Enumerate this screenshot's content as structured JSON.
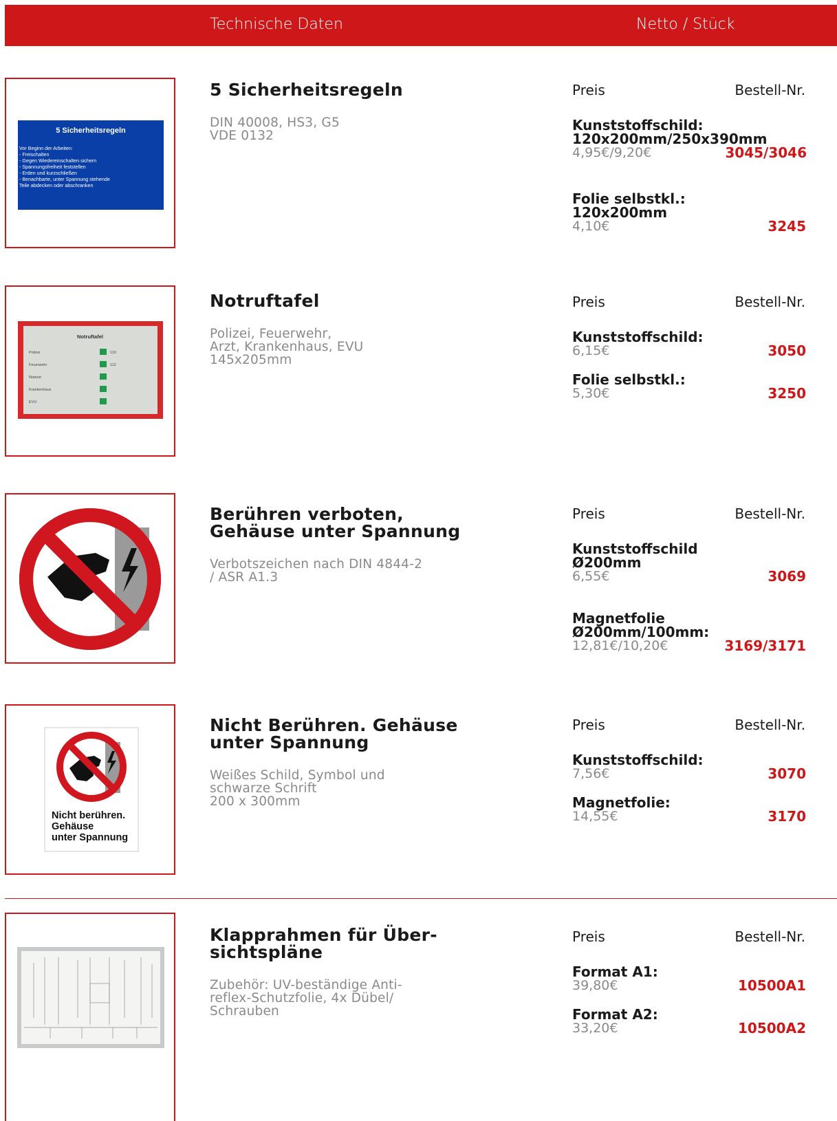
{
  "header": {
    "left": "Technische Daten",
    "right": "Netto / Stück"
  },
  "colors": {
    "accent": "#cd1719",
    "muted": "#8a8a8a"
  },
  "products": [
    {
      "title": "5 Sicherheitsregeln",
      "description": "DIN 40008, HS3, G5\nVDE 0132",
      "price_label": "Preis",
      "order_label": "Bestell-Nr.",
      "image": {
        "heading": "5 Sicherheitsregeln",
        "lines": [
          "Vor Beginn der Arbeiten:",
          "- Freischalten",
          "- Gegen Wiedereinschalten sichern",
          "- Spannungsfreiheit feststellen",
          "- Erden und kurzschließen",
          "- Benachbarte, unter Spannung stehende",
          "  Teile abdecken oder abschranken"
        ]
      },
      "options": [
        {
          "name": "Kunststoffschild:\n120x200mm/250x390mm",
          "price": "4,95€/9,20€",
          "nr": "3045/3046"
        },
        {
          "name": "Folie selbstkl.:\n120x200mm",
          "price": "4,10€",
          "nr": "3245"
        }
      ]
    },
    {
      "title": "Notruftafel",
      "description": "Polizei, Feuerwehr,\nArzt, Krankenhaus, EVU\n145x205mm",
      "price_label": "Preis",
      "order_label": "Bestell-Nr.",
      "image": {
        "heading": "Notruftafel",
        "rows": [
          {
            "label": "Polizei",
            "num": "110"
          },
          {
            "label": "Feuerwehr",
            "num": "112"
          },
          {
            "label": "Notarzt",
            "num": ""
          },
          {
            "label": "Krankenhaus",
            "num": ""
          },
          {
            "label": "EVU",
            "num": ""
          }
        ]
      },
      "options": [
        {
          "name": "Kunststoffschild:",
          "price": "6,15€",
          "nr": "3050"
        },
        {
          "name": "Folie selbstkl.:",
          "price": "5,30€",
          "nr": "3250"
        }
      ]
    },
    {
      "title": "Berühren verboten,\nGehäuse unter Spannung",
      "description": "Verbotszeichen nach DIN 4844-2\n/ ASR A1.3",
      "price_label": "Preis",
      "order_label": "Bestell-Nr.",
      "options": [
        {
          "name": "Kunststoffschild\nØ200mm",
          "price": "6,55€",
          "nr": "3069"
        },
        {
          "name": "Magnetfolie\nØ200mm/100mm:",
          "price": "12,81€/10,20€",
          "nr": "3169/3171"
        }
      ]
    },
    {
      "title": "Nicht Berühren. Gehäuse\nunter Spannung",
      "description": "Weißes Schild, Symbol und\nschwarze Schrift\n200 x 300mm",
      "price_label": "Preis",
      "order_label": "Bestell-Nr.",
      "image": {
        "lines": [
          "Nicht berühren.",
          "Gehäuse",
          "unter Spannung"
        ]
      },
      "options": [
        {
          "name": "Kunststoffschild:",
          "price": "7,56€",
          "nr": "3070"
        },
        {
          "name": "Magnetfolie:",
          "price": "14,55€",
          "nr": "3170"
        }
      ]
    },
    {
      "title": "Klapprahmen für Über-\nsichtspläne",
      "description": "Zubehör: UV-beständige Anti-\nreflex-Schutzfolie, 4x Dübel/\nSchrauben",
      "price_label": "Preis",
      "order_label": "Bestell-Nr.",
      "options": [
        {
          "name": "Format A1:",
          "price": "39,80€",
          "nr": "10500A1"
        },
        {
          "name": "Format A2:",
          "price": "33,20€",
          "nr": "10500A2"
        }
      ]
    }
  ]
}
